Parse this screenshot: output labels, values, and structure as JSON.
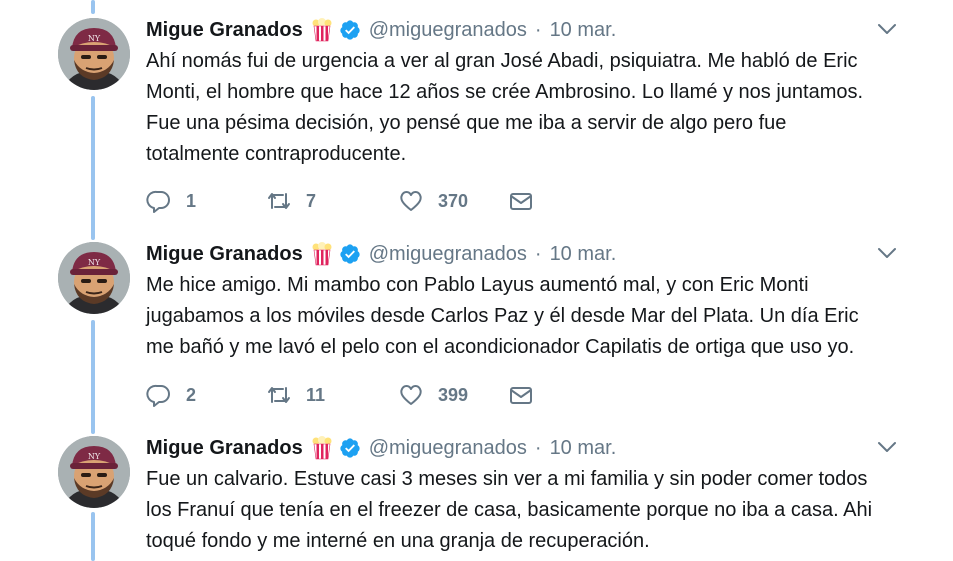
{
  "tweets": [
    {
      "name": "Migue Granados",
      "handle": "@miguegranados",
      "separator": "·",
      "date": "10 mar.",
      "lines": [
        "Ahí nomás fui de urgencia a ver al gran José Abadi, psiquiatra. Me habló de Eric",
        "Monti, el hombre que hace 12 años se crée Ambrosino. Lo llamé y nos juntamos.",
        "Fue una pésima decisión, yo pensé que me iba a servir de algo pero fue",
        "totalmente contraproducente."
      ],
      "replies": "1",
      "retweets": "7",
      "likes": "370"
    },
    {
      "name": "Migue Granados",
      "handle": "@miguegranados",
      "separator": "·",
      "date": "10 mar.",
      "lines": [
        "Me hice amigo. Mi mambo con Pablo Layus aumentó mal, y con Eric Monti",
        "jugabamos a los móviles desde Carlos Paz y él desde Mar del Plata. Un día Eric",
        "me bañó y me lavó el pelo con el acondicionador Capilatis de ortiga que uso yo."
      ],
      "replies": "2",
      "retweets": "11",
      "likes": "399"
    },
    {
      "name": "Migue Granados",
      "handle": "@miguegranados",
      "separator": "·",
      "date": "10 mar.",
      "lines": [
        "Fue un calvario. Estuve casi 3 meses sin ver a mi familia y sin poder comer todos",
        "los Franuí que tenía en el freezer de casa, basicamente porque no iba a casa. Ahi",
        "toqué fondo y me interné en una granja de recuperación."
      ]
    }
  ],
  "colors": {
    "thread_line": "#99c4ef",
    "verified": "#1da1f2",
    "muted": "#657786",
    "text": "#14171a"
  },
  "icons": {
    "reply": "reply-icon",
    "retweet": "retweet-icon",
    "like": "heart-icon",
    "dm": "envelope-icon",
    "menu": "chevron-down-icon",
    "verified": "verified-badge-icon",
    "emoji": "popcorn-emoji-icon"
  }
}
